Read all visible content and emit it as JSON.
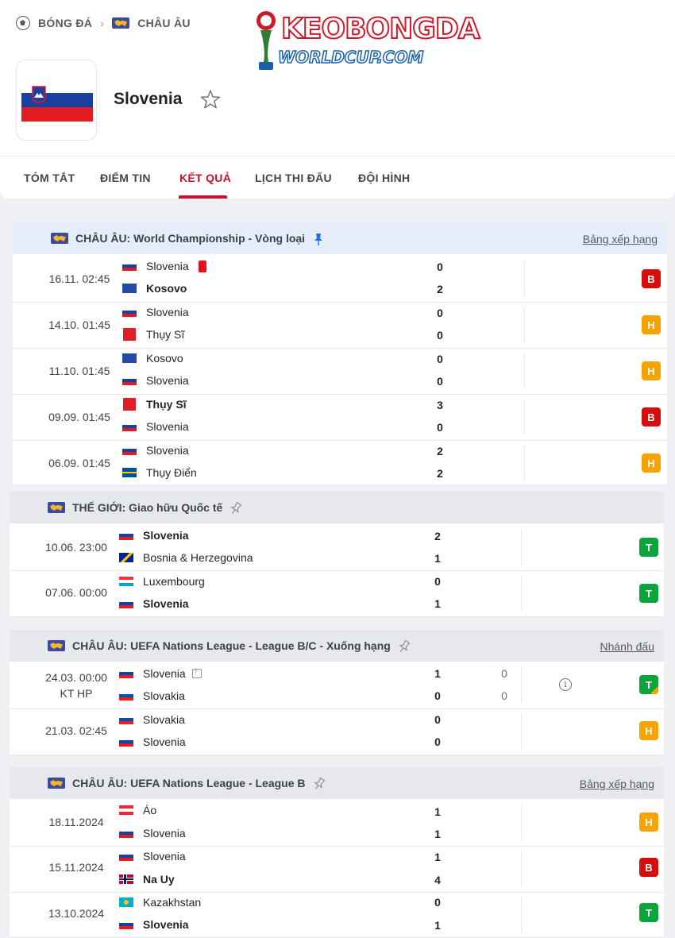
{
  "breadcrumb": {
    "sport": "BÓNG ĐÁ",
    "region": "CHÂU ÂU"
  },
  "logo": {
    "line1": "KEOBONGDA",
    "line2": "WORLDCUP.COM"
  },
  "team": {
    "name": "Slovenia"
  },
  "tabs": [
    "TÓM TẮT",
    "ĐIỂM TIN",
    "KẾT QUẢ",
    "LỊCH THI ĐẤU",
    "ĐỘI HÌNH"
  ],
  "active_tab": "KẾT QUẢ",
  "colors": {
    "accent": "#c8102e",
    "loss": "#d50e0e",
    "draw": "#f4a300",
    "win": "#0aa43b"
  },
  "leagues": [
    {
      "title": "CHÂU ÂU: World Championship - Vòng loại",
      "link": "Bảng xếp hạng",
      "matches": [
        {
          "time": "16.11. 02:45",
          "home": "Slovenia",
          "away": "Kosovo",
          "hs": "0",
          "as": "2",
          "result": "B"
        },
        {
          "time": "14.10. 01:45",
          "home": "Slovenia",
          "away": "Thụy Sĩ",
          "hs": "0",
          "as": "0",
          "result": "H"
        },
        {
          "time": "11.10. 01:45",
          "home": "Kosovo",
          "away": "Slovenia",
          "hs": "0",
          "as": "0",
          "result": "H"
        },
        {
          "time": "09.09. 01:45",
          "home": "Thụy Sĩ",
          "away": "Slovenia",
          "hs": "3",
          "as": "0",
          "result": "B"
        },
        {
          "time": "06.09. 01:45",
          "home": "Slovenia",
          "away": "Thụy Điển",
          "hs": "2",
          "as": "2",
          "result": "H"
        }
      ]
    },
    {
      "title": "THẾ GIỚI: Giao hữu Quốc tế",
      "link": "",
      "matches": [
        {
          "time": "10.06. 23:00",
          "home": "Slovenia",
          "away": "Bosnia & Herzegovina",
          "hs": "2",
          "as": "1",
          "result": "T"
        },
        {
          "time": "07.06. 00:00",
          "home": "Luxembourg",
          "away": "Slovenia",
          "hs": "0",
          "as": "1",
          "result": "T"
        }
      ]
    },
    {
      "title": "CHÂU ÂU: UEFA Nations League - League B/C - Xuống hạng",
      "link": "Nhánh đấu",
      "matches": [
        {
          "time": "24.03. 00:00",
          "time2": "KT HP",
          "home": "Slovenia",
          "away": "Slovakia",
          "hs": "1",
          "as": "0",
          "hp": "0",
          "ap": "0",
          "result": "T"
        },
        {
          "time": "21.03. 02:45",
          "home": "Slovakia",
          "away": "Slovenia",
          "hs": "0",
          "as": "0",
          "result": "H"
        }
      ]
    },
    {
      "title": "CHÂU ÂU: UEFA Nations League - League B",
      "link": "Bảng xếp hạng",
      "matches": [
        {
          "time": "18.11.2024",
          "home": "Áo",
          "away": "Slovenia",
          "hs": "1",
          "as": "1",
          "result": "H"
        },
        {
          "time": "15.11.2024",
          "home": "Slovenia",
          "away": "Na Uy",
          "hs": "1",
          "as": "4",
          "result": "B"
        },
        {
          "time": "13.10.2024",
          "home": "Kazakhstan",
          "away": "Slovenia",
          "hs": "0",
          "as": "1",
          "result": "T"
        }
      ]
    }
  ],
  "icons": {
    "sport": "soccer-ball-icon",
    "region": "europe-map-icon",
    "favorite": "star-icon",
    "pin": "pin-icon",
    "info": "info-icon"
  }
}
